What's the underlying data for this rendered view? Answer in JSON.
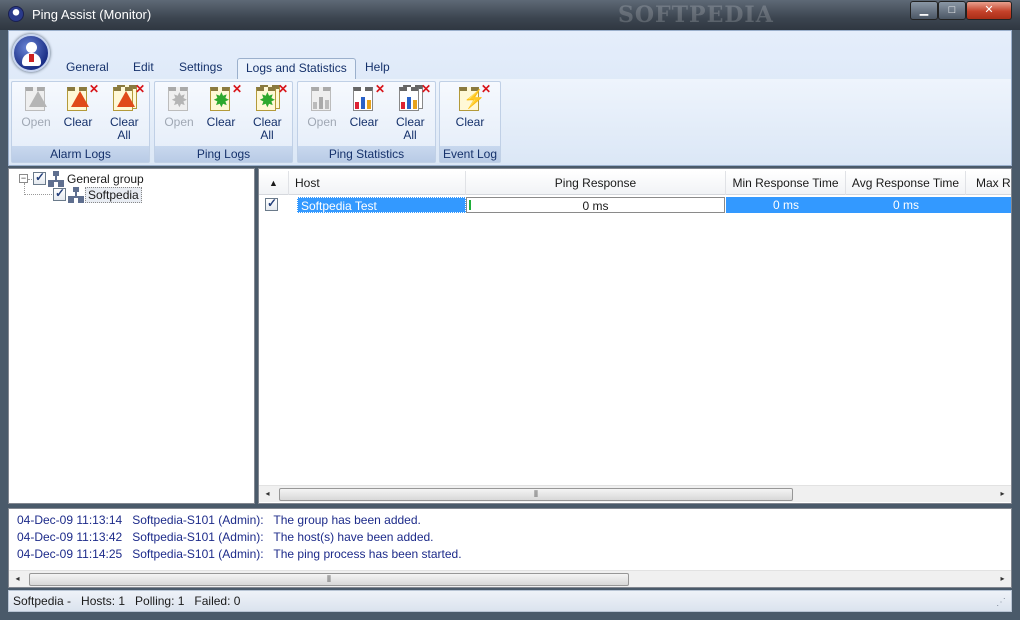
{
  "window": {
    "title": "Ping Assist  (Monitor)",
    "watermark": "SOFTPEDIA",
    "controls": {
      "minimize": "▁",
      "maximize": "□",
      "close": "✕"
    }
  },
  "ribbon": {
    "tabs": [
      {
        "label": "General",
        "active": false
      },
      {
        "label": "Edit",
        "active": false
      },
      {
        "label": "Settings",
        "active": false
      },
      {
        "label": "Logs and Statistics",
        "active": true
      },
      {
        "label": "Help",
        "active": false
      }
    ],
    "groups": [
      {
        "label": "Alarm Logs",
        "buttons": [
          {
            "label": "Open",
            "enabled": false,
            "icon": "alarm-log-open-icon"
          },
          {
            "label": "Clear",
            "enabled": true,
            "icon": "alarm-log-clear-icon"
          },
          {
            "label": "Clear All",
            "enabled": true,
            "icon": "alarm-log-clear-all-icon"
          }
        ]
      },
      {
        "label": "Ping Logs",
        "buttons": [
          {
            "label": "Open",
            "enabled": false,
            "icon": "ping-log-open-icon"
          },
          {
            "label": "Clear",
            "enabled": true,
            "icon": "ping-log-clear-icon"
          },
          {
            "label": "Clear All",
            "enabled": true,
            "icon": "ping-log-clear-all-icon"
          }
        ]
      },
      {
        "label": "Ping Statistics",
        "buttons": [
          {
            "label": "Open",
            "enabled": false,
            "icon": "ping-stats-open-icon"
          },
          {
            "label": "Clear",
            "enabled": true,
            "icon": "ping-stats-clear-icon"
          },
          {
            "label": "Clear All",
            "enabled": true,
            "icon": "ping-stats-clear-all-icon"
          }
        ]
      },
      {
        "label": "Event Log",
        "buttons": [
          {
            "label": "Clear",
            "enabled": true,
            "icon": "event-log-clear-icon"
          }
        ]
      }
    ]
  },
  "tree": {
    "items": [
      {
        "label": "General group",
        "checked": true,
        "expanded": true
      },
      {
        "label": "Softpedia",
        "checked": true,
        "selected": true
      }
    ]
  },
  "grid": {
    "sort_indicator": "▲",
    "columns": [
      "Host",
      "Ping Response",
      "Min Response Time",
      "Avg Response Time",
      "Max Re"
    ],
    "rows": [
      {
        "checked": true,
        "host": "Softpedia Test",
        "ping_response": "0 ms",
        "min": "0 ms",
        "avg": "0 ms",
        "max": ""
      }
    ],
    "scroll_left": "◂",
    "scroll_right": "▸",
    "scroll_grip": "⦀"
  },
  "event_log": {
    "entries": [
      {
        "time": "04-Dec-09 11:13:14",
        "source": "Softpedia-S101 (Admin):",
        "message": "The group has been added."
      },
      {
        "time": "04-Dec-09 11:13:42",
        "source": "Softpedia-S101 (Admin):",
        "message": "The host(s) have been added."
      },
      {
        "time": "04-Dec-09 11:14:25",
        "source": "Softpedia-S101 (Admin):",
        "message": "The ping process has been started."
      }
    ],
    "scroll_left": "◂",
    "scroll_right": "▸",
    "scroll_grip": "⦀"
  },
  "status": {
    "text": "Softpedia -   Hosts: 1   Polling: 1   Failed: 0"
  },
  "colors": {
    "accent_selection": "#3399ff",
    "log_text": "#1d2b8a",
    "ribbon_text": "#15316b",
    "delete_mark": "#d8141a"
  }
}
